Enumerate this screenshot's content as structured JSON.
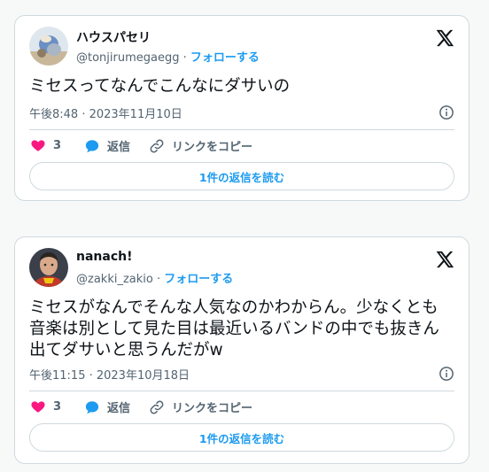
{
  "tweets": [
    {
      "name": "ハウスパセリ",
      "handle": "@tonjirumegaegg",
      "separator": "·",
      "follow_label": "フォローする",
      "text": "ミセスってなんでこんなにダサいの",
      "timestamp": "午後8:48 · 2023年11月10日",
      "like_count": "3",
      "reply_label": "返信",
      "copy_link_label": "リンクをコピー",
      "read_replies_label": "1件の返信を読む"
    },
    {
      "name": "nanach!",
      "handle": "@zakki_zakio",
      "separator": "·",
      "follow_label": "フォローする",
      "text_lines": [
        "ミセスがなんでそんな人気なのかわからん。少なくとも",
        "音楽は別として見た目は最近いるバンドの中でも抜きん",
        "出てダサいと思うんだがw"
      ],
      "timestamp": "午後11:15 · 2023年10月18日",
      "like_count": "3",
      "reply_label": "返信",
      "copy_link_label": "リンクをコピー",
      "read_replies_label": "1件の返信を読む"
    }
  ],
  "icons": {
    "logo": "x-logo-icon",
    "info": "info-icon",
    "like": "heart-icon",
    "reply": "reply-bubble-icon",
    "copy": "link-icon"
  },
  "colors": {
    "accent": "#1d9bf0",
    "like": "#f91880",
    "secondary_text": "#536471",
    "border": "#cfd9de"
  }
}
